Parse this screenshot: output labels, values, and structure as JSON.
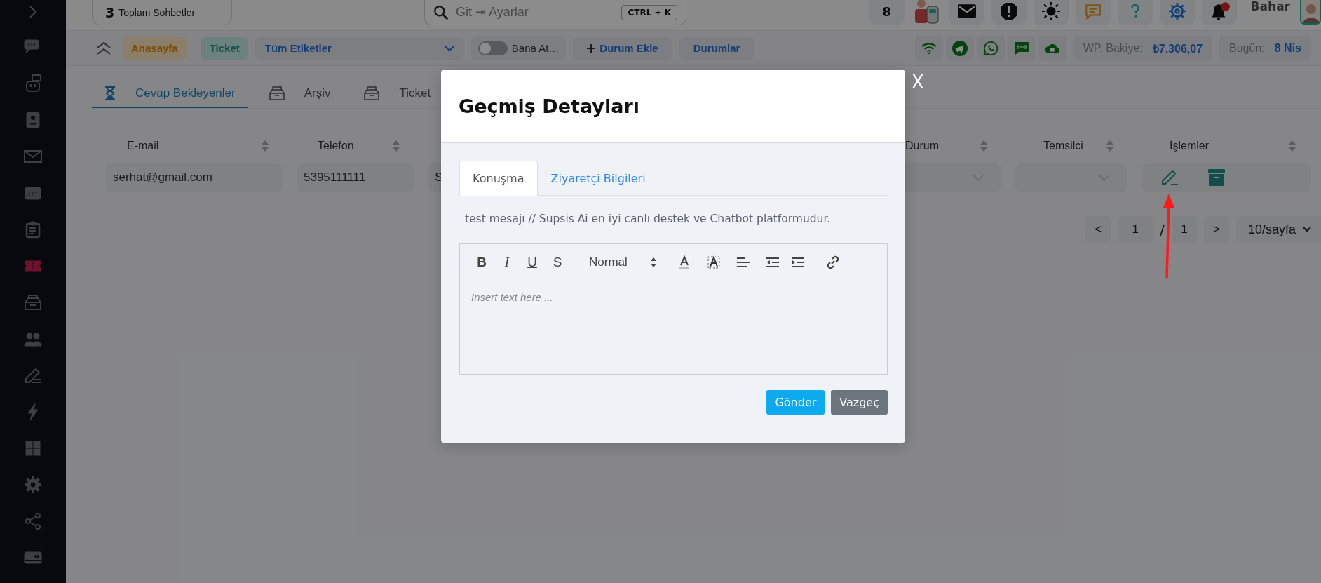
{
  "sidebar": {
    "items": [
      {
        "selected": false
      },
      {
        "selected": false
      },
      {
        "selected": false
      },
      {
        "selected": false
      },
      {
        "selected": false
      },
      {
        "selected": false
      },
      {
        "selected": true
      },
      {
        "selected": false
      },
      {
        "selected": false
      },
      {
        "selected": false
      },
      {
        "selected": false
      },
      {
        "selected": false
      },
      {
        "selected": false
      },
      {
        "selected": false
      },
      {
        "selected": false
      }
    ]
  },
  "top_bar": {
    "chat_count": "3",
    "chat_label": "Toplam Sohbetler",
    "search": {
      "placeholder": "Git ⇥ Ayarlar",
      "shortcut": "CTRL + K"
    },
    "queue_count": "8",
    "user": "Bahar"
  },
  "filter_bar": {
    "home": "Anasayfa",
    "ticket": "Ticket",
    "tag_select": "Tüm Etiketler",
    "assign_toggle": {
      "label": "Bana At…",
      "on": false
    },
    "add_status": "Durum Ekle",
    "statuses": "Durumlar",
    "balance_label": "WP. Bakiye:",
    "balance": "₺7.306,07",
    "today_label": "Bugün:",
    "today": "8 Nis"
  },
  "tabs": [
    {
      "label": "Cevap Bekleyenler",
      "selected": true
    },
    {
      "label": "Arşiv",
      "selected": false
    },
    {
      "label": "Ticket",
      "selected": false
    }
  ],
  "table": {
    "columns": [
      "E-mail",
      "Telefon",
      "Durum",
      "Temsilci",
      "İşlemler"
    ],
    "rows": [
      {
        "email": "serhat@gmail.com",
        "phone": "5395111111",
        "column_3": "S"
      }
    ]
  },
  "pagination": {
    "prev": "<",
    "page": "1",
    "separator": "/",
    "total": "1",
    "next": ">",
    "page_size": "10/sayfa"
  },
  "modal": {
    "title": "Geçmiş Detayları",
    "close": "X",
    "tabs": [
      {
        "label": "Konuşma",
        "selected": true
      },
      {
        "label": "Ziyaretçi Bilgileri",
        "selected": false
      }
    ],
    "message": "test mesajı // Supsis Ai en iyi canlı destek ve Chatbot platformudur.",
    "editor": {
      "format_buttons": [
        {
          "label": "B",
          "kind": "bold"
        },
        {
          "label": "I",
          "kind": "italic"
        },
        {
          "label": "U",
          "kind": "underline"
        },
        {
          "label": "S",
          "kind": "strike"
        }
      ],
      "style_select": "Normal",
      "placeholder": "Insert text here ..."
    },
    "buttons": [
      {
        "label": "Gönder",
        "kind": "primary"
      },
      {
        "label": "Vazgeç",
        "kind": "secondary"
      }
    ]
  }
}
